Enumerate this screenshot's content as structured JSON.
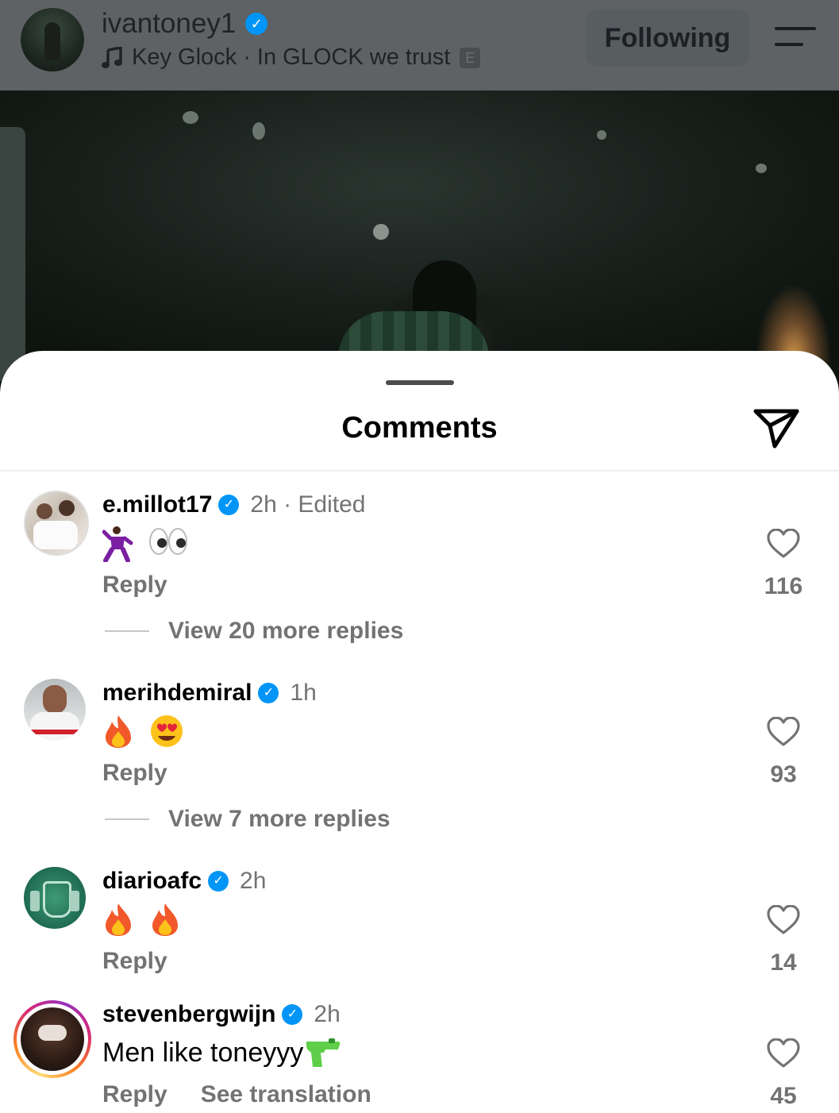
{
  "header": {
    "username": "ivantoney1",
    "song": "Key Glock · In GLOCK we trust",
    "explicit_badge": "E",
    "follow_label": "Following"
  },
  "sheet": {
    "title": "Comments"
  },
  "comments": [
    {
      "username": "e.millot17",
      "meta": "2h · Edited",
      "text": "",
      "emojis": [
        "dancer-emoji",
        "eyes-emoji"
      ],
      "reply_label": "Reply",
      "likes": "116",
      "view_more": "View 20 more replies"
    },
    {
      "username": "merihdemiral",
      "meta": "1h",
      "text": "",
      "emojis": [
        "fire-emoji",
        "heart-eyes-emoji"
      ],
      "reply_label": "Reply",
      "likes": "93",
      "view_more": "View 7 more replies"
    },
    {
      "username": "diarioafc",
      "meta": "2h",
      "text": "",
      "emojis": [
        "fire-emoji",
        "fire-emoji"
      ],
      "reply_label": "Reply",
      "likes": "14"
    },
    {
      "username": "stevenbergwijn",
      "meta": "2h",
      "text": "Men like toneyyy",
      "emojis": [
        "water-pistol-emoji"
      ],
      "reply_label": "Reply",
      "translation_label": "See translation",
      "likes": "45"
    }
  ],
  "colors": {
    "verified": "#0095f6",
    "secondary_text": "#737373",
    "story_ring": [
      "#feda75",
      "#fa7e1e",
      "#d62976",
      "#962fbf"
    ]
  }
}
